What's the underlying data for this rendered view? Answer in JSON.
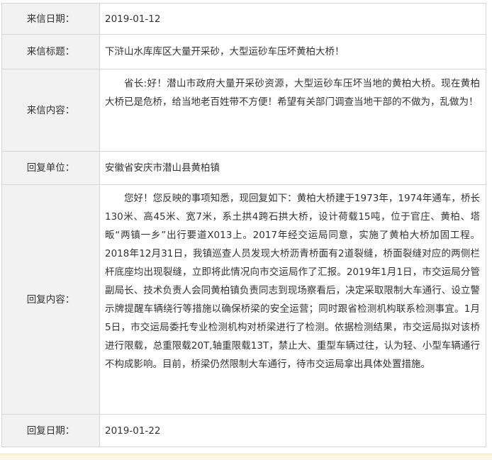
{
  "letter": {
    "date_label": "来信日期：",
    "date_value": "2019-01-12",
    "title_label": "来信标题：",
    "title_value": "下浒山水库库区大量开采砂，大型运砂车压坏黄柏大桥！",
    "content_label": "来信内容：",
    "content_value": "省长:好！潜山市政府大量开采砂资源，大型运砂车压坏当地的黄柏大桥。现在黄柏大桥已是危桥，给当地老百姓带不方便！希望有关部门调查当地干部的不做为，乱做为！"
  },
  "reply": {
    "unit_label": "回复单位：",
    "unit_value": "安徽省安庆市潜山县黄柏镇",
    "content_label": "回复内容：",
    "content_value": "您好！您反映的事项知悉，现回复如下：黄柏大桥建于1973年，1974年通车，桥长130米、高45米、宽7米，系土拱4跨石拱大桥，设计荷载15吨，位于官庄、黄柏、塔畈“两镇一乡”出行要道X013上。2017年经交运局同意，实施了黄柏大桥加固工程。2018年12月31日，我镇巡查人员发现大桥沥青桥面有2道裂缝，桥面裂缝对应的两侧栏杆底座均出现裂缝，立即将此情况向市交运局作了汇报。2019年1月1日，市交运局分管副局长、技术负责人会同黄柏镇负责同志到现场察看后，决定采取限制大车通行、设立警示牌提醒车辆绕行等措施以确保桥梁的安全运营；同时跟省检测机构联系检测事宜。1月5日，市交运局委托专业检测机构对桥梁进行了检测。依据检测结果，市交运局拟对该桥进行限载，总重限载20T,轴重限载13T，禁止大、重型车辆过往，认为轻、小型车辆通行不构成影响。目前，桥梁仍然限制大车通行，待市交运局拿出具体处置措施。",
    "date_label": "回复日期：",
    "date_value": "2019-01-22"
  }
}
